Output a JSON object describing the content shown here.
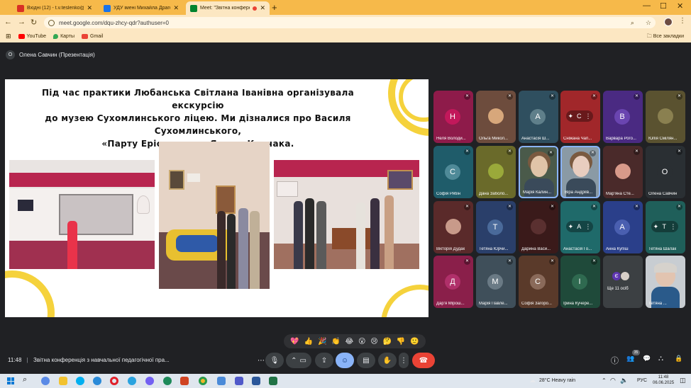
{
  "browser": {
    "tabs": [
      {
        "label": "Вхідні (12) - t.v.teslenko@npu.e",
        "color": "#d93025"
      },
      {
        "label": "УДУ імені Михайла Драгоманова",
        "color": "#1a73e8"
      },
      {
        "label": "Meet: \"Звітна конференція з н",
        "color": "#00832d"
      }
    ],
    "new_tab": "+",
    "window_controls": [
      "—",
      "☐",
      "✕"
    ],
    "url": "meet.google.com/dqu-zhcy-qdr?authuser=0",
    "bookmarks": [
      {
        "label": "YouTube",
        "color": "#ff0000"
      },
      {
        "label": "Карты",
        "color": "#34a853"
      },
      {
        "label": "Gmail",
        "color": "#ea4335"
      }
    ],
    "all_bookmarks": "Все закладки"
  },
  "meet": {
    "presenter_initial": "О",
    "presenter_label": "Олена Савчин (Презентація)",
    "slide_text_lines": [
      "Під час практики Любанська Світлана Іванівна організувала екскурсію",
      "до музею Сухомлинського ліцею. Ми дізналися про Василя Сухомлинського,",
      "«Парту Ерісмана» та Януша Корчака."
    ],
    "participants": [
      {
        "name": "Неля Володи...",
        "initial": "Н",
        "bg": "#8e1b4a",
        "circle": "#c2185b",
        "kind": "circle"
      },
      {
        "name": "Ольга Микол...",
        "initial": "",
        "bg": "#6d4c3d",
        "circle": "#d7a77b",
        "kind": "photo"
      },
      {
        "name": "Анастасія Ш...",
        "initial": "А",
        "bg": "#2f4f5f",
        "circle": "#5f7f8a",
        "kind": "circle"
      },
      {
        "name": "Сніжана Чап...",
        "initial": "С",
        "bg": "#a1272a",
        "circle": "#c5453e",
        "kind": "pin"
      },
      {
        "name": "Варвара Рого...",
        "initial": "В",
        "bg": "#4a2a82",
        "circle": "#6a45b0",
        "kind": "circle"
      },
      {
        "name": "Юлія Смілян...",
        "initial": "",
        "bg": "#5a5230",
        "circle": "#8a8050",
        "kind": "photo"
      },
      {
        "name": "Софія Рябін",
        "initial": "С",
        "bg": "#1f5c6a",
        "circle": "#4f8a98",
        "kind": "circle"
      },
      {
        "name": "Дана Заболо...",
        "initial": "",
        "bg": "#6a6a2a",
        "circle": "#9aa93a",
        "kind": "photo"
      },
      {
        "name": "Марія Калин...",
        "initial": "",
        "bg": "#4a5a4a",
        "circle": "#e0c4a8",
        "kind": "video"
      },
      {
        "name": "Віра Андріїв...",
        "initial": "",
        "bg": "#8a9aa5",
        "circle": "#e8cdbf",
        "kind": "video"
      },
      {
        "name": "Мар'яна Сте...",
        "initial": "",
        "bg": "#4a2a2a",
        "circle": "#d89a8a",
        "kind": "photo"
      },
      {
        "name": "Олена Савчин",
        "initial": "О",
        "bg": "#2a2f33",
        "circle": "#2a2f33",
        "kind": "circle"
      },
      {
        "name": "Вікторія Дудак",
        "initial": "",
        "bg": "#5a2a2a",
        "circle": "#c89a8a",
        "kind": "photo"
      },
      {
        "name": "Тетяна Юрчи...",
        "initial": "Т",
        "bg": "#2a3f6a",
        "circle": "#4a6a9a",
        "kind": "circle"
      },
      {
        "name": "Дарина Васи...",
        "initial": "",
        "bg": "#3a1a1a",
        "circle": "#5a3030",
        "kind": "photo"
      },
      {
        "name": "Анастасія Го...",
        "initial": "А",
        "bg": "#1f6a6a",
        "circle": "#3f8a8a",
        "kind": "pin"
      },
      {
        "name": "Анна Купіш",
        "initial": "А",
        "bg": "#2a3f8a",
        "circle": "#4a5fb0",
        "kind": "circle"
      },
      {
        "name": "Тетяна Шалак",
        "initial": "Т",
        "bg": "#1f5f5a",
        "circle": "#3f7f7a",
        "kind": "pin"
      },
      {
        "name": "Дар'я Мірош...",
        "initial": "Д",
        "bg": "#8a1f4a",
        "circle": "#b0306a",
        "kind": "circle"
      },
      {
        "name": "Марія Павле...",
        "initial": "М",
        "bg": "#3f4f5a",
        "circle": "#6a7a85",
        "kind": "circle"
      },
      {
        "name": "Софія Загоро...",
        "initial": "С",
        "bg": "#5a3a2a",
        "circle": "#8a6a5a",
        "kind": "circle"
      },
      {
        "name": "Ірина Кучере...",
        "initial": "І",
        "bg": "#1f4a3a",
        "circle": "#2f6a50",
        "kind": "circle"
      }
    ],
    "others_label": "Ще 11 осіб",
    "self_tile_name": "Тетяна ...",
    "reactions": [
      "💖",
      "👍",
      "🎉",
      "👏",
      "😂",
      "😮",
      "😢",
      "🤔",
      "👎",
      "🙂"
    ],
    "clock": "11:48",
    "meeting_title": "Звітна конференція з навчальної педагогічної пра...",
    "participant_count": "35",
    "controls": {
      "more": "⋯",
      "mic": "🎙",
      "caret": "⌃",
      "camera": "▭",
      "present": "⇪",
      "emoji": "☺",
      "captions": "▤",
      "hand": "✋",
      "options": "⋮",
      "end": "☎"
    },
    "right_controls": [
      "ⓘ",
      "👥",
      "💬",
      "⛬",
      "🔒"
    ]
  },
  "taskbar": {
    "weather": "28°C  Heavy rain",
    "lang": "РУС",
    "time": "11:48",
    "date": "06.06.2025"
  }
}
